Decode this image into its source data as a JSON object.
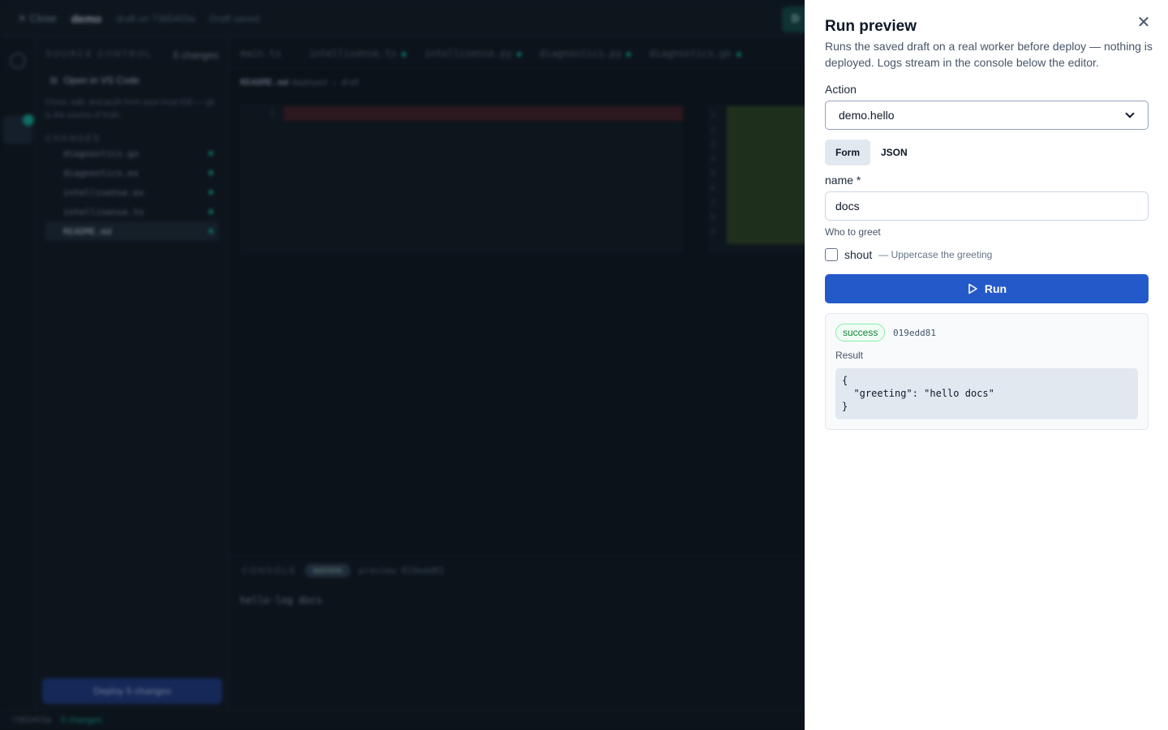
{
  "background": {
    "topbar": {
      "close_label": "✕  Close",
      "project": "demo",
      "draft_info": "draft on 7365403a",
      "saved_status": "Draft saved",
      "deploy_short": "D"
    },
    "sidebar": {
      "header": "SOURCE CONTROL",
      "count": "5 changes",
      "open_vscode": "Open in VS Code",
      "hint": "Clone, edit, and push from your local IDE — git is the source of truth.",
      "changes_header": "CHANGES",
      "files": [
        "diagnostics.go",
        "diagnostics.ex",
        "intellisense.ex",
        "intellisense.ts",
        "README.md"
      ],
      "deploy_label": "Deploy 5 changes"
    },
    "tabs": [
      "main.ts",
      "intellisense.ts",
      "intellisense.py",
      "diagnostics.py",
      "diagnostics.go"
    ],
    "breadcrumb": {
      "file": "README.md",
      "meta": "deployed → draft"
    },
    "editor": {
      "left_line": "1",
      "right_lines": [
        "1",
        "2",
        "3",
        "4",
        "5",
        "6",
        "7",
        "8",
        "9",
        "10"
      ]
    },
    "console": {
      "title": "CONSOLE",
      "status": "success",
      "run_ref": "preview 019edd81",
      "log": "hello·log docs"
    },
    "statusbar": {
      "commit": "7365403a",
      "changes": "5 changes"
    }
  },
  "drawer": {
    "title": "Run preview",
    "description": "Runs the saved draft on a real worker before deploy — nothing is deployed. Logs stream in the console below the editor.",
    "action_label": "Action",
    "action_value": "demo.hello",
    "mode_tabs": {
      "form": "Form",
      "json": "JSON"
    },
    "field_name_label": "name *",
    "field_name_value": "docs",
    "field_name_help": "Who to greet",
    "shout_label": "shout",
    "shout_desc": "— Uppercase the greeting",
    "shout_checked": false,
    "run_label": "Run",
    "result": {
      "status": "success",
      "run_id": "019edd81",
      "label": "Result",
      "json": "{\n  \"greeting\": \"hello docs\"\n}"
    },
    "colors": {
      "primary": "#2459c9",
      "success": "#15803d"
    }
  }
}
